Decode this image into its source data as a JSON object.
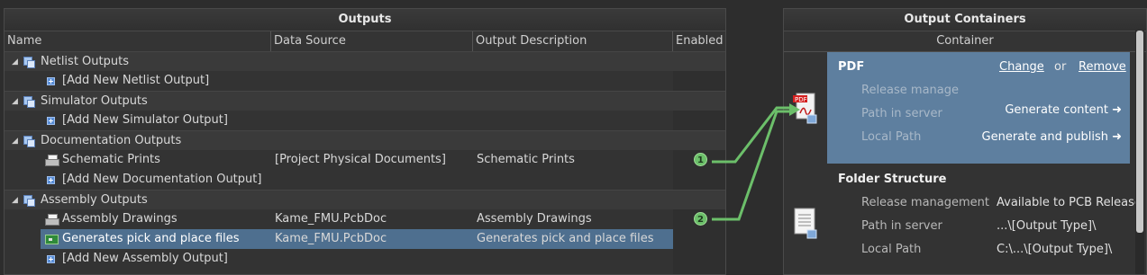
{
  "outputs_panel": {
    "title": "Outputs",
    "columns": [
      "Name",
      "Data Source",
      "Output Description",
      "Enabled"
    ],
    "rows": [
      {
        "type": "group",
        "name": "Netlist Outputs"
      },
      {
        "type": "add",
        "name": "[Add New Netlist Output]"
      },
      {
        "type": "group",
        "name": "Simulator Outputs"
      },
      {
        "type": "add",
        "name": "[Add New Simulator Output]"
      },
      {
        "type": "group",
        "name": "Documentation Outputs"
      },
      {
        "type": "item",
        "icon": "printer-icon",
        "name": "Schematic Prints",
        "source": "[Project Physical Documents]",
        "desc": "Schematic Prints",
        "badge": "1"
      },
      {
        "type": "add",
        "name": "[Add New Documentation Output]"
      },
      {
        "type": "group",
        "name": "Assembly Outputs"
      },
      {
        "type": "item",
        "icon": "printer-icon",
        "name": "Assembly Drawings",
        "source": "Kame_FMU.PcbDoc",
        "desc": "Assembly Drawings",
        "badge": "2"
      },
      {
        "type": "item",
        "icon": "pcb-icon",
        "name": "Generates pick and place files",
        "source": "Kame_FMU.PcbDoc",
        "desc": "Generates pick and place files",
        "selected": true
      },
      {
        "type": "add",
        "name": "[Add New Assembly Output]"
      }
    ]
  },
  "containers_panel": {
    "title": "Output Containers",
    "subheader": "Container",
    "pdf": {
      "title": "PDF",
      "change": "Change",
      "or": "or",
      "remove": "Remove",
      "fields": [
        "Release manage",
        "Path in server",
        "Local Path"
      ],
      "actions": [
        "Generate content ➜",
        "Generate and publish ➜"
      ]
    },
    "folder": {
      "title": "Folder Structure",
      "fields": [
        {
          "label": "Release management",
          "value": "Available to PCB Release"
        },
        {
          "label": "Path in server",
          "value": "...\\[Output Type]\\"
        },
        {
          "label": "Local Path",
          "value": "C:\\...\\[Output Type]\\"
        }
      ]
    }
  },
  "colors": {
    "selection": "#4e6f8f",
    "pdf_box": "#5e7f9f",
    "badge": "#6cbf6a",
    "connector": "#6cbf6a"
  }
}
